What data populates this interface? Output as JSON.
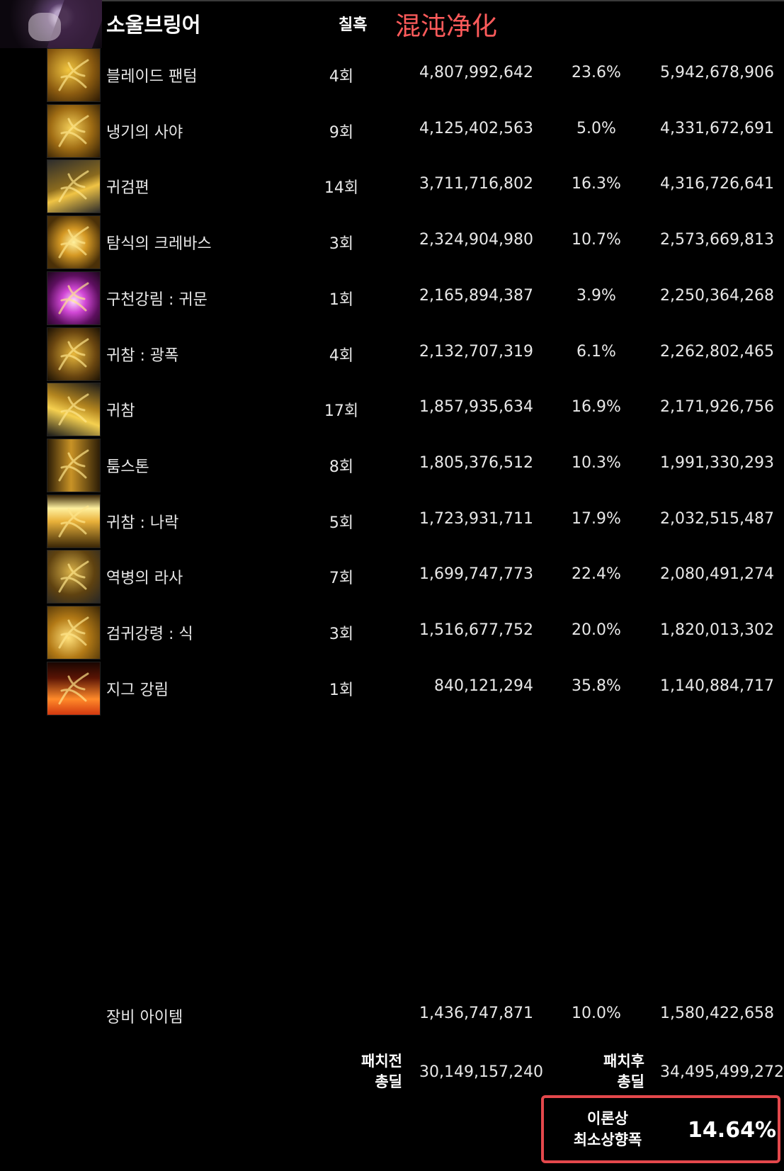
{
  "header": {
    "title": "소울브링어",
    "count_header": "칠흑",
    "overlay_text": "混沌净化"
  },
  "skills": [
    {
      "name": "블레이드 팬텀",
      "count": "4회",
      "before": "4,807,992,642",
      "pct": "23.6%",
      "after": "5,942,678,906",
      "icon": "blade-phantom-icon"
    },
    {
      "name": "냉기의 사야",
      "count": "9회",
      "before": "4,125,402,563",
      "pct": "5.0%",
      "after": "4,331,672,691",
      "icon": "saya-icon"
    },
    {
      "name": "귀검편",
      "count": "14회",
      "before": "3,711,716,802",
      "pct": "16.3%",
      "after": "4,316,726,641",
      "icon": "ghost-sword-icon"
    },
    {
      "name": "탐식의 크레바스",
      "count": "3회",
      "before": "2,324,904,980",
      "pct": "10.7%",
      "after": "2,573,669,813",
      "icon": "crevasse-icon"
    },
    {
      "name": "구천강림 : 귀문",
      "count": "1회",
      "before": "2,165,894,387",
      "pct": "3.9%",
      "after": "2,250,364,268",
      "icon": "gwimun-icon"
    },
    {
      "name": "귀참 : 광폭",
      "count": "4회",
      "before": "2,132,707,319",
      "pct": "6.1%",
      "after": "2,262,802,465",
      "icon": "rage-slash-icon"
    },
    {
      "name": "귀참",
      "count": "17회",
      "before": "1,857,935,634",
      "pct": "16.9%",
      "after": "2,171,926,756",
      "icon": "ghost-slash-icon"
    },
    {
      "name": "툼스톤",
      "count": "8회",
      "before": "1,805,376,512",
      "pct": "10.3%",
      "after": "1,991,330,293",
      "icon": "tombstone-icon"
    },
    {
      "name": "귀참 : 나락",
      "count": "5회",
      "before": "1,723,931,711",
      "pct": "17.9%",
      "after": "2,032,515,487",
      "icon": "abyss-slash-icon"
    },
    {
      "name": "역병의 라사",
      "count": "7회",
      "before": "1,699,747,773",
      "pct": "22.4%",
      "after": "2,080,491,274",
      "icon": "rasa-icon"
    },
    {
      "name": "검귀강령 : 식",
      "count": "3회",
      "before": "1,516,677,752",
      "pct": "20.0%",
      "after": "1,820,013,302",
      "icon": "sword-spirit-icon"
    },
    {
      "name": "지그 강림",
      "count": "1회",
      "before": "840,121,294",
      "pct": "35.8%",
      "after": "1,140,884,717",
      "icon": "zig-icon"
    }
  ],
  "equipment": {
    "name": "장비 아이템",
    "before": "1,436,747,871",
    "pct": "10.0%",
    "after": "1,580,422,658"
  },
  "totals": {
    "before_label_1": "패치전",
    "before_label_2": "총딜",
    "before_value": "30,149,157,240",
    "after_label_1": "패치후",
    "after_label_2": "총딜",
    "after_value": "34,495,499,272"
  },
  "result": {
    "label_1": "이론상",
    "label_2": "최소상향폭",
    "value": "14.64%"
  },
  "colors": {
    "highlight_border": "#e4484c",
    "overlay_text": "#ff5b5b",
    "icon_gold": "#d7a429"
  }
}
